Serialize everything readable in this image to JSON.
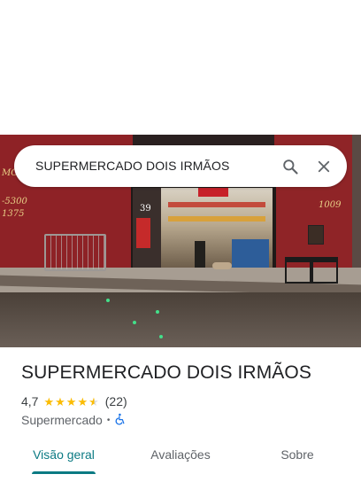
{
  "search": {
    "query": "SUPERMERCADO DOIS IRMÃOS"
  },
  "place": {
    "name": "SUPERMERCADO DOIS IRMÃOS",
    "rating": "4,7",
    "rating_value": 4.7,
    "review_count": "(22)",
    "category": "Supermercado",
    "separator": "•",
    "accessibility_icon": "wheelchair-icon"
  },
  "photo": {
    "wall_text_left_1": "MO",
    "wall_text_left_2": "-5300",
    "wall_text_left_3": "1375",
    "wall_number_right": "1009",
    "door_number": "39"
  },
  "tabs": [
    {
      "label": "Visão geral",
      "active": true
    },
    {
      "label": "Avaliações",
      "active": false
    },
    {
      "label": "Sobre",
      "active": false
    }
  ],
  "colors": {
    "accent": "#0b7a83",
    "star": "#fbbc04",
    "wall_red": "#8e2226"
  }
}
